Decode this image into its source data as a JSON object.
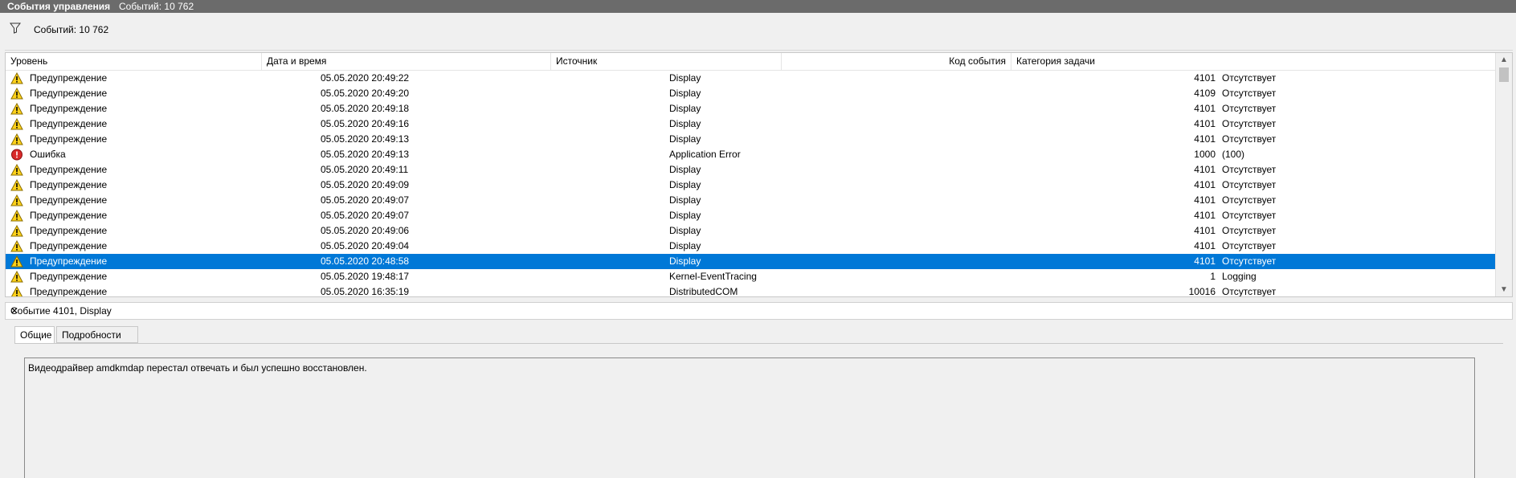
{
  "window": {
    "title": "События управления",
    "event_count_text": "Событий: 10 762"
  },
  "filter": {
    "icon": "filter-icon",
    "count_text": "Событий: 10 762"
  },
  "columns": [
    "Уровень",
    "Дата и время",
    "Источник",
    "Код события",
    "Категория задачи"
  ],
  "events": [
    {
      "level": "Предупреждение",
      "icon": "warning",
      "datetime": "05.05.2020 20:49:22",
      "source": "Display",
      "id": "4101",
      "category": "Отсутствует",
      "selected": false
    },
    {
      "level": "Предупреждение",
      "icon": "warning",
      "datetime": "05.05.2020 20:49:20",
      "source": "Display",
      "id": "4109",
      "category": "Отсутствует",
      "selected": false
    },
    {
      "level": "Предупреждение",
      "icon": "warning",
      "datetime": "05.05.2020 20:49:18",
      "source": "Display",
      "id": "4101",
      "category": "Отсутствует",
      "selected": false
    },
    {
      "level": "Предупреждение",
      "icon": "warning",
      "datetime": "05.05.2020 20:49:16",
      "source": "Display",
      "id": "4101",
      "category": "Отсутствует",
      "selected": false
    },
    {
      "level": "Предупреждение",
      "icon": "warning",
      "datetime": "05.05.2020 20:49:13",
      "source": "Display",
      "id": "4101",
      "category": "Отсутствует",
      "selected": false
    },
    {
      "level": "Ошибка",
      "icon": "error",
      "datetime": "05.05.2020 20:49:13",
      "source": "Application Error",
      "id": "1000",
      "category": "(100)",
      "selected": false
    },
    {
      "level": "Предупреждение",
      "icon": "warning",
      "datetime": "05.05.2020 20:49:11",
      "source": "Display",
      "id": "4101",
      "category": "Отсутствует",
      "selected": false
    },
    {
      "level": "Предупреждение",
      "icon": "warning",
      "datetime": "05.05.2020 20:49:09",
      "source": "Display",
      "id": "4101",
      "category": "Отсутствует",
      "selected": false
    },
    {
      "level": "Предупреждение",
      "icon": "warning",
      "datetime": "05.05.2020 20:49:07",
      "source": "Display",
      "id": "4101",
      "category": "Отсутствует",
      "selected": false
    },
    {
      "level": "Предупреждение",
      "icon": "warning",
      "datetime": "05.05.2020 20:49:07",
      "source": "Display",
      "id": "4101",
      "category": "Отсутствует",
      "selected": false
    },
    {
      "level": "Предупреждение",
      "icon": "warning",
      "datetime": "05.05.2020 20:49:06",
      "source": "Display",
      "id": "4101",
      "category": "Отсутствует",
      "selected": false
    },
    {
      "level": "Предупреждение",
      "icon": "warning",
      "datetime": "05.05.2020 20:49:04",
      "source": "Display",
      "id": "4101",
      "category": "Отсутствует",
      "selected": false
    },
    {
      "level": "Предупреждение",
      "icon": "warning",
      "datetime": "05.05.2020 20:48:58",
      "source": "Display",
      "id": "4101",
      "category": "Отсутствует",
      "selected": true
    },
    {
      "level": "Предупреждение",
      "icon": "warning",
      "datetime": "05.05.2020 19:48:17",
      "source": "Kernel-EventTracing",
      "id": "1",
      "category": "Logging",
      "selected": false
    },
    {
      "level": "Предупреждение",
      "icon": "warning",
      "datetime": "05.05.2020 16:35:19",
      "source": "DistributedCOM",
      "id": "10016",
      "category": "Отсутствует",
      "selected": false
    }
  ],
  "detail": {
    "title": "Событие 4101, Display",
    "close_icon": "close-icon",
    "tabs": [
      "Общие",
      "Подробности"
    ],
    "active_tab": "Общие",
    "message": "Видеодрайвер amdkmdap перестал отвечать и был успешно восстановлен."
  },
  "colors": {
    "titlebar": "#6b6b6b",
    "selection": "#0078d7",
    "warning_fill": "#ffd21a",
    "error_fill": "#d92b2b"
  }
}
